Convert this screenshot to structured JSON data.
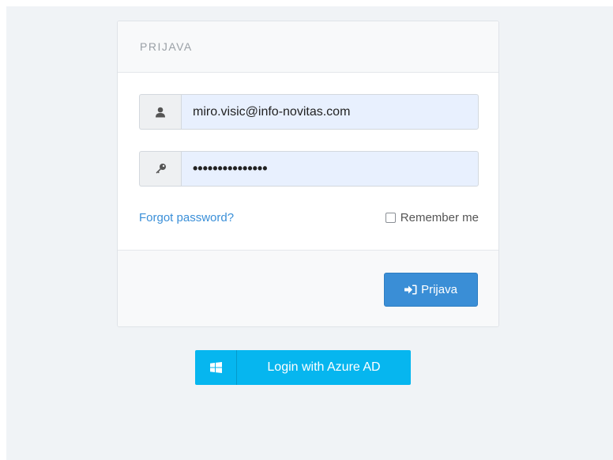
{
  "panel": {
    "title": "PRIJAVA"
  },
  "form": {
    "username": {
      "value": "miro.visic@info-novitas.com",
      "icon": "user-icon"
    },
    "password": {
      "value": "•••••••••••••••",
      "icon": "key-icon"
    },
    "forgot_label": "Forgot password?",
    "remember_label": "Remember me",
    "remember_checked": false,
    "submit_label": "Prijava",
    "submit_icon": "sign-in-icon"
  },
  "azure": {
    "label": "Login with Azure AD",
    "icon": "windows-icon"
  },
  "colors": {
    "primary": "#3a8ed6",
    "link": "#3a8fd8",
    "azure": "#06b6ef",
    "input_autofill": "#e8f0fe",
    "page_background": "#f0f3f6"
  }
}
